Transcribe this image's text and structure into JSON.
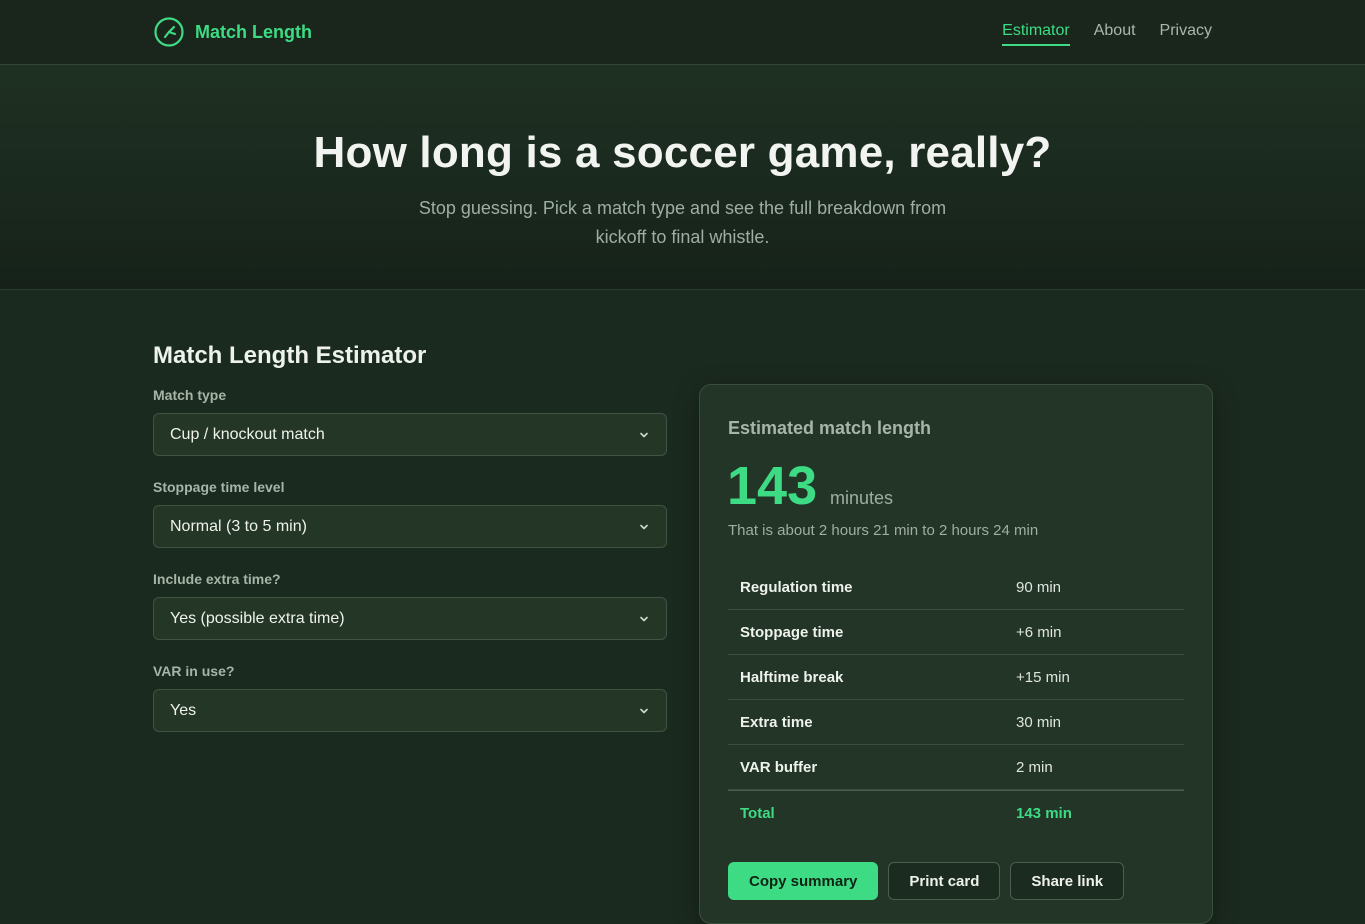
{
  "brand": {
    "name": "Match Length",
    "icon": "clock-icon"
  },
  "nav": {
    "items": [
      "Estimator",
      "About",
      "Privacy"
    ],
    "active": "Estimator"
  },
  "hero": {
    "title": "How long is a soccer game, really?",
    "subtitle": "Stop guessing. Pick a match type and see the full breakdown from kickoff to final whistle."
  },
  "estimator": {
    "title": "Match Length Estimator",
    "fields": [
      {
        "label": "Match type",
        "value": "Cup / knockout match"
      },
      {
        "label": "Stoppage time level",
        "value": "Normal (3 to 5 min)"
      },
      {
        "label": "Include extra time?",
        "value": "Yes (possible extra time)"
      },
      {
        "label": "VAR in use?",
        "value": "Yes"
      }
    ]
  },
  "result": {
    "title": "Estimated match length",
    "value": "143",
    "unit": "minutes",
    "approx": "That is about 2 hours 21 min to 2 hours 24 min",
    "rows": [
      {
        "label": "Regulation time",
        "value": "90 min"
      },
      {
        "label": "Stoppage time",
        "value": "+6 min"
      },
      {
        "label": "Halftime break",
        "value": "+15 min"
      },
      {
        "label": "Extra time",
        "value": "30 min"
      },
      {
        "label": "VAR buffer",
        "value": "2 min"
      }
    ],
    "total": {
      "label": "Total",
      "value": "143 min"
    },
    "buttons": [
      "Copy summary",
      "Print card",
      "Share link"
    ]
  },
  "colors": {
    "accent": "#3ddc84",
    "background": "#1b2a1e",
    "card": "#233527"
  }
}
